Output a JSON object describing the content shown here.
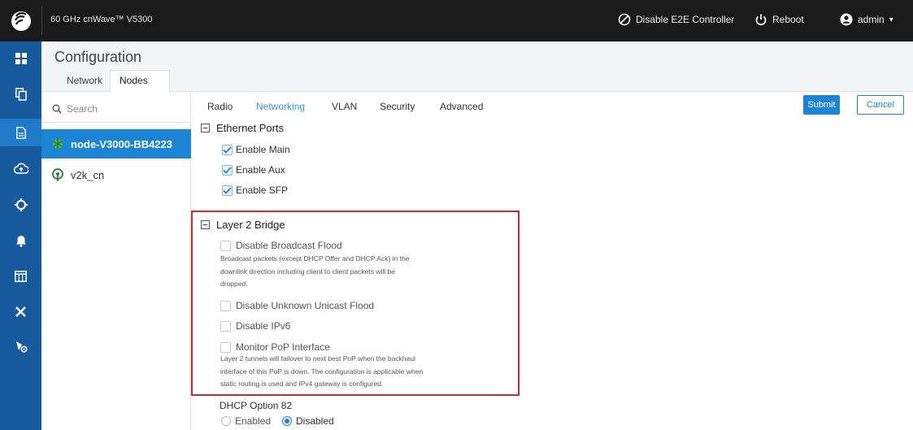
{
  "topbar": {
    "title": "60 GHz cnWave™ V5300",
    "disable_controller": "Disable E2E Controller",
    "reboot": "Reboot",
    "user": "admin",
    "user_caret": "▾"
  },
  "rail": {
    "icons": [
      "dashboard-icon",
      "copy-icon",
      "configuration-icon",
      "cloud-upload-icon",
      "target-icon",
      "bell-icon",
      "calendar-icon",
      "tools-icon",
      "network-settings-icon"
    ],
    "active_index": 2
  },
  "header": {
    "title": "Configuration",
    "tabs": [
      "Network",
      "Nodes"
    ],
    "active_tab": "Nodes"
  },
  "nodes": {
    "search_placeholder": "Search",
    "items": [
      {
        "name": "node-V3000-BB4223",
        "selected": true
      },
      {
        "name": "v2k_cn",
        "selected": false
      }
    ]
  },
  "main": {
    "tabs": [
      "Radio",
      "Networking",
      "VLAN",
      "Security",
      "Advanced"
    ],
    "active_tab": "Networking",
    "submit": "Submit",
    "cancel": "Cancel",
    "ethernet": {
      "title": "Ethernet Ports",
      "options": [
        {
          "label": "Enable Main",
          "checked": true
        },
        {
          "label": "Enable Aux",
          "checked": true
        },
        {
          "label": "Enable SFP",
          "checked": true
        }
      ]
    },
    "l2bridge": {
      "title": "Layer 2 Bridge",
      "broadcast_flood": "Disable Broadcast Flood",
      "broadcast_desc_1": "Broadcast packets (except DHCP Offer and DHCP Ack) in the",
      "broadcast_desc_2": "downlink direction including client to client packets will be",
      "broadcast_desc_3": "dropped.",
      "unicast_flood": "Disable Unknown Unicast Flood",
      "ipv6": "Disable IPv6",
      "monitor_pop": "Monitor PoP Interface",
      "monitor_desc_1": "Layer 2 tunnels will failover to next best PoP when the backhaul",
      "monitor_desc_2": "interface of this PoP is down. The configuration is applicable when",
      "monitor_desc_3": "static routing is used and IPv4 gateway is configured."
    },
    "dhcp": {
      "title": "DHCP Option 82",
      "enabled": "Enabled",
      "disabled": "Disabled",
      "selected": "Disabled"
    }
  },
  "colors": {
    "topbar": "#1a1a1a",
    "rail": "#175a9e",
    "accent": "#1c84d4",
    "highlight": "#cc2b2b"
  }
}
